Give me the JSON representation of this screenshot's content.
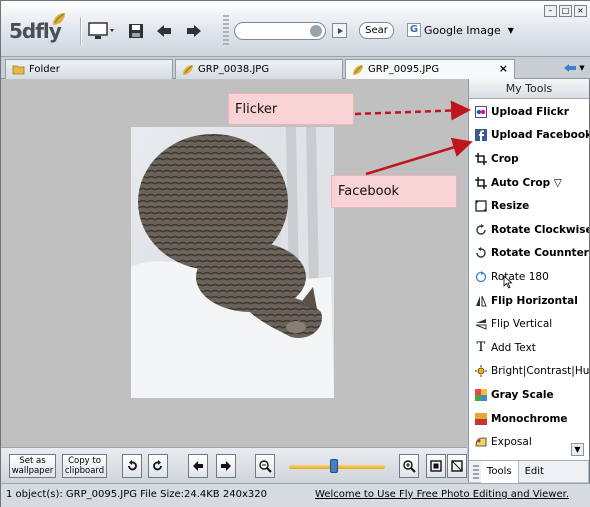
{
  "app": {
    "logo": "5dfly",
    "search": {
      "value": "",
      "placeholder": "",
      "button_label": "Sear"
    },
    "engine_label": "Google Image",
    "engine_mark": "G"
  },
  "window_controls": [
    "–",
    "□",
    "×"
  ],
  "tabs": [
    {
      "label": "Folder"
    },
    {
      "label": "GRP_0038.JPG"
    },
    {
      "label": "GRP_0095.JPG",
      "close": "×"
    }
  ],
  "tools": {
    "title": "My Tools",
    "items": [
      {
        "label": "Upload Flickr",
        "icon": "flickr-icon",
        "bold": true
      },
      {
        "label": "Upload Facebook",
        "icon": "facebook-icon",
        "bold": true
      },
      {
        "label": "Crop",
        "icon": "crop-icon",
        "bold": true
      },
      {
        "label": "Auto Crop ▽",
        "icon": "auto-crop-icon",
        "bold": true
      },
      {
        "label": "Resize",
        "icon": "resize-icon",
        "bold": true
      },
      {
        "label": "Rotate Clockwise",
        "icon": "rotate-clockwise-icon",
        "bold": true
      },
      {
        "label": "Rotate Counnter-clo",
        "icon": "rotate-counter-icon",
        "bold": true
      },
      {
        "label": "Rotate 180",
        "icon": "rotate-180-icon",
        "bold": false
      },
      {
        "label": "Flip Horizontal",
        "icon": "flip-horizontal-icon",
        "bold": true
      },
      {
        "label": "Flip Vertical",
        "icon": "flip-vertical-icon",
        "bold": false
      },
      {
        "label": "Add Text",
        "icon": "add-text-icon",
        "bold": false
      },
      {
        "label": "Bright|Contrast|Hue",
        "icon": "bright-icon",
        "bold": false
      },
      {
        "label": "Gray Scale",
        "icon": "gray-scale-icon",
        "bold": true
      },
      {
        "label": "Monochrome",
        "icon": "monochrome-icon",
        "bold": true
      },
      {
        "label": "Exposal",
        "icon": "exposal-icon",
        "bold": false
      }
    ],
    "panel_tabs": [
      "Tools",
      "Edit History"
    ]
  },
  "bottom": {
    "wallpaper_label": "Set as wallpaper",
    "clipboard_label": "Copy to clipboard",
    "zoom_level": 0.47
  },
  "status": {
    "left": "1 object(s):  GRP_0095.JPG  File Size:24.4KB  240x320",
    "right": "Welcome to Use Fly Free Photo Editing and Viewer."
  },
  "callouts": {
    "flickr": "Flicker",
    "facebook": "Facebook"
  },
  "colors": {
    "arrow": "#c0151d",
    "callout_bg": "#f8d3d5",
    "panel_title_bg": "#d9dee4"
  }
}
